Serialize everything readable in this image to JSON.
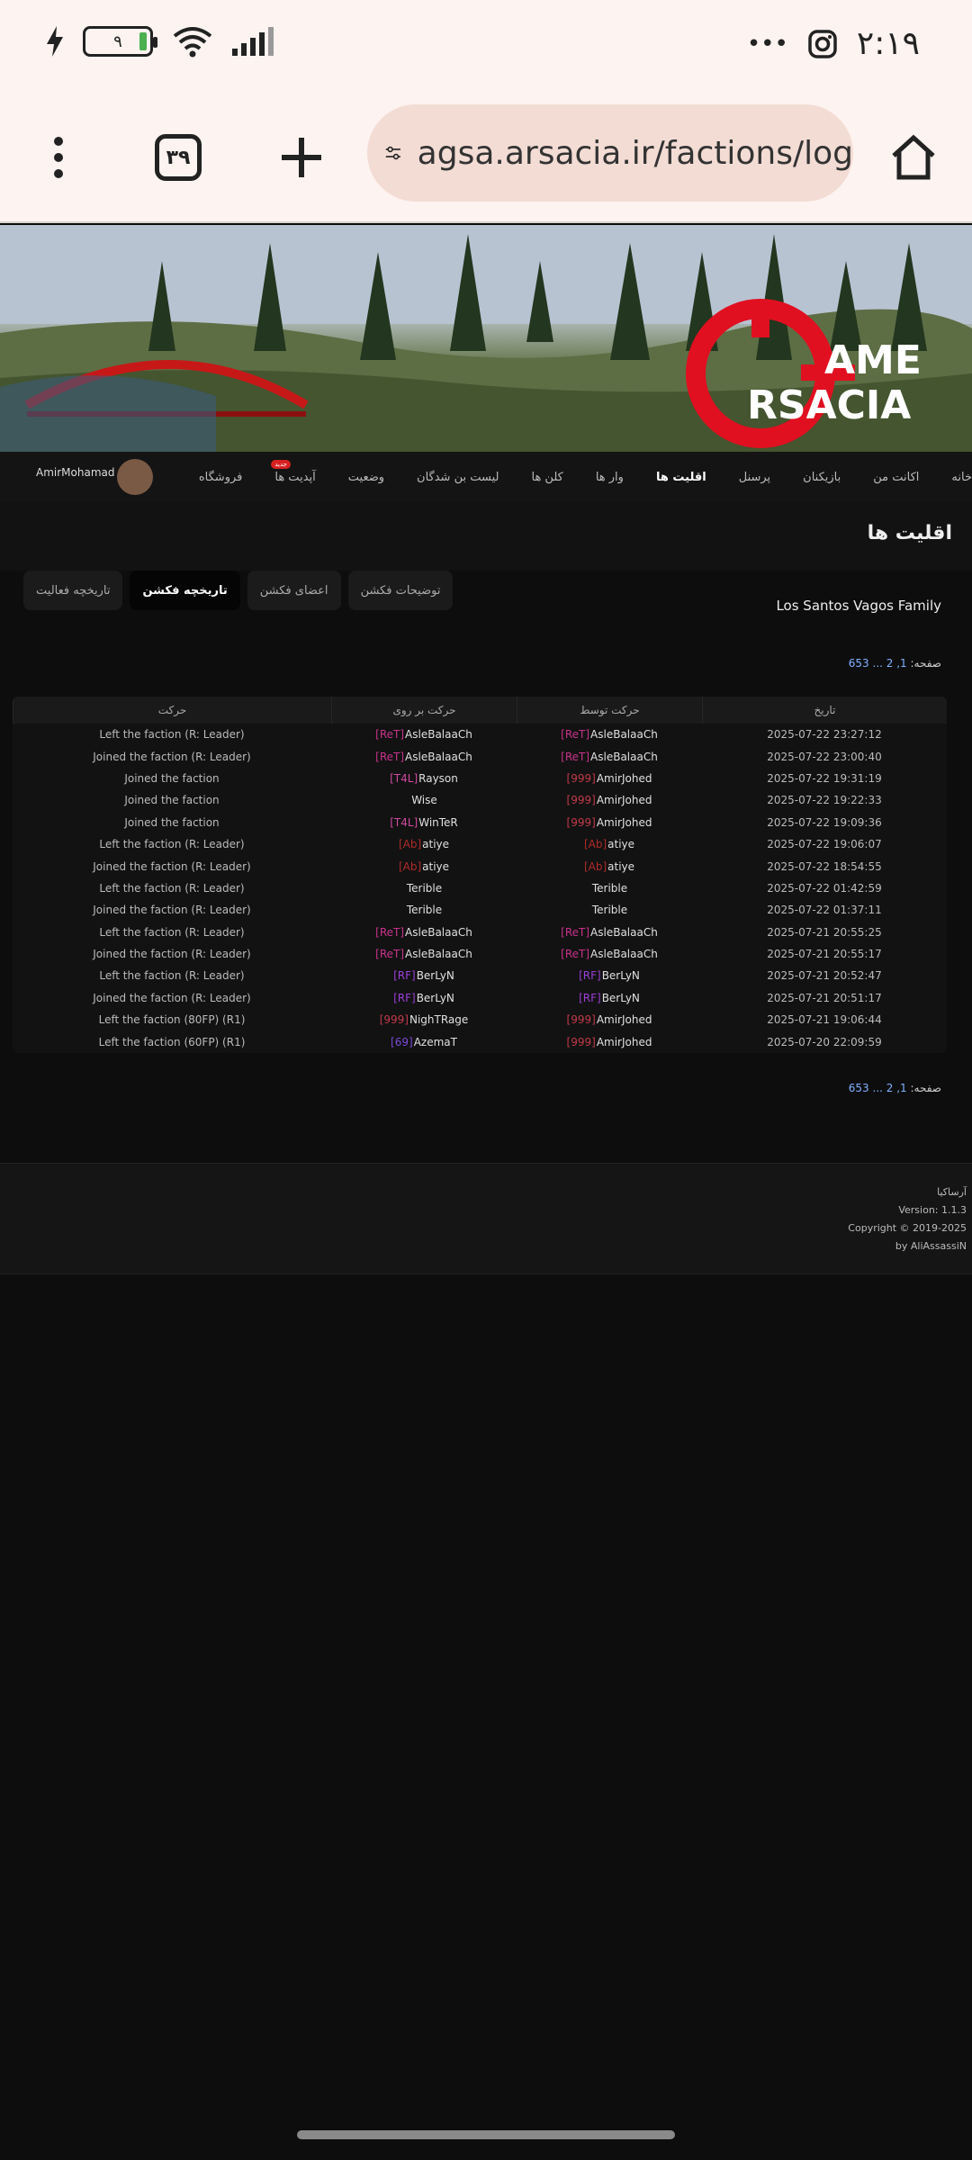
{
  "status": {
    "battery": "۹",
    "time": "۲:۱۹",
    "more": "•••"
  },
  "browser": {
    "url": "agsa.arsacia.ir/factions/log",
    "tab_count": "۳۹"
  },
  "logo": {
    "line1": "AME",
    "line2": "RSACIA"
  },
  "nav": {
    "user": "AmirMohamad",
    "items": [
      "خانه",
      "اکانت من",
      "بازیکنان",
      "پرسنل",
      "اقلیت ها",
      "وار ها",
      "کلن ها",
      "لیست بن شدگان",
      "وضعیت",
      "آپدیت ها",
      "فروشگاه"
    ],
    "active_index": 4,
    "badge": "جدید"
  },
  "page": {
    "title": "اقلیت ها",
    "faction_name": "Los Santos Vagos Family",
    "tabs": [
      "توضیحات فکشن",
      "اعضای فکشن",
      "تاریخچه فکشن",
      "تاریخچه فعالیت"
    ],
    "active_tab": 2,
    "pager_prefix": "صفحه:",
    "pager_pages": "1, 2 ... 653"
  },
  "table": {
    "headers": {
      "date": "تاریخ",
      "by": "حرکت توسط",
      "target": "حرکت بر روی",
      "action": "حرکت"
    },
    "rows": [
      {
        "date": "2025-07-22 23:27:12",
        "by_tag": "[ReT]",
        "by_tag_color": "#c8328c",
        "by": "AsleBalaaCh",
        "target_tag": "[ReT]",
        "target_tag_color": "#c8328c",
        "target": "AsleBalaaCh",
        "action": "Left the faction (R: Leader)"
      },
      {
        "date": "2025-07-22 23:00:40",
        "by_tag": "[ReT]",
        "by_tag_color": "#c8328c",
        "by": "AsleBalaaCh",
        "target_tag": "[ReT]",
        "target_tag_color": "#c8328c",
        "target": "AsleBalaaCh",
        "action": "Joined the faction (R: Leader)"
      },
      {
        "date": "2025-07-22 19:31:19",
        "by_tag": "[999]",
        "by_tag_color": "#c23a4a",
        "by": "AmirJohed",
        "target_tag": "[T4L]",
        "target_tag_color": "#d04aa0",
        "target": "Rayson",
        "action": "Joined the faction"
      },
      {
        "date": "2025-07-22 19:22:33",
        "by_tag": "[999]",
        "by_tag_color": "#c23a4a",
        "by": "AmirJohed",
        "target_tag": "",
        "target_tag_color": "#c23a4a",
        "target": "Wise",
        "action": "Joined the faction"
      },
      {
        "date": "2025-07-22 19:09:36",
        "by_tag": "[999]",
        "by_tag_color": "#c23a4a",
        "by": "AmirJohed",
        "target_tag": "[T4L]",
        "target_tag_color": "#d04aa0",
        "target": "WinTeR",
        "action": "Joined the faction"
      },
      {
        "date": "2025-07-22 19:06:07",
        "by_tag": "[Ab]",
        "by_tag_color": "#b12a2a",
        "by": "atiye",
        "target_tag": "[Ab]",
        "target_tag_color": "#b12a2a",
        "target": "atiye",
        "action": "Left the faction (R: Leader)"
      },
      {
        "date": "2025-07-22 18:54:55",
        "by_tag": "[Ab]",
        "by_tag_color": "#b12a2a",
        "by": "atiye",
        "target_tag": "[Ab]",
        "target_tag_color": "#b12a2a",
        "target": "atiye",
        "action": "Joined the faction (R: Leader)"
      },
      {
        "date": "2025-07-22 01:42:59",
        "by_tag": "",
        "by_tag_color": "#bbbbbb",
        "by": "Terible",
        "target_tag": "",
        "target_tag_color": "#bbbbbb",
        "target": "Terible",
        "action": "Left the faction (R: Leader)"
      },
      {
        "date": "2025-07-22 01:37:11",
        "by_tag": "",
        "by_tag_color": "#bbbbbb",
        "by": "Terible",
        "target_tag": "",
        "target_tag_color": "#bbbbbb",
        "target": "Terible",
        "action": "Joined the faction (R: Leader)"
      },
      {
        "date": "2025-07-21 20:55:25",
        "by_tag": "[ReT]",
        "by_tag_color": "#c8328c",
        "by": "AsleBalaaCh",
        "target_tag": "[ReT]",
        "target_tag_color": "#c8328c",
        "target": "AsleBalaaCh",
        "action": "Left the faction (R: Leader)"
      },
      {
        "date": "2025-07-21 20:55:17",
        "by_tag": "[ReT]",
        "by_tag_color": "#c8328c",
        "by": "AsleBalaaCh",
        "target_tag": "[ReT]",
        "target_tag_color": "#c8328c",
        "target": "AsleBalaaCh",
        "action": "Joined the faction (R: Leader)"
      },
      {
        "date": "2025-07-21 20:52:47",
        "by_tag": "[RF]",
        "by_tag_color": "#9b3fd6",
        "by": "BerLyN",
        "target_tag": "[RF]",
        "target_tag_color": "#9b3fd6",
        "target": "BerLyN",
        "action": "Left the faction (R: Leader)"
      },
      {
        "date": "2025-07-21 20:51:17",
        "by_tag": "[RF]",
        "by_tag_color": "#9b3fd6",
        "by": "BerLyN",
        "target_tag": "[RF]",
        "target_tag_color": "#9b3fd6",
        "target": "BerLyN",
        "action": "Joined the faction (R: Leader)"
      },
      {
        "date": "2025-07-21 19:06:44",
        "by_tag": "[999]",
        "by_tag_color": "#c23a4a",
        "by": "AmirJohed",
        "target_tag": "[999]",
        "target_tag_color": "#c23a4a",
        "target": "NighTRage",
        "action": "Left the faction (80FP) (R1)"
      },
      {
        "date": "2025-07-20 22:09:59",
        "by_tag": "[999]",
        "by_tag_color": "#c23a4a",
        "by": "AmirJohed",
        "target_tag": "[69]",
        "target_tag_color": "#7a4ad6",
        "target": "AzemaT",
        "action": "Left the faction (60FP) (R1)"
      }
    ]
  },
  "footer": {
    "brand": "آرساکیا",
    "version": "Version: 1.1.3",
    "copyright": "Copyright © 2019-2025",
    "author": "by AliAssassiN"
  }
}
